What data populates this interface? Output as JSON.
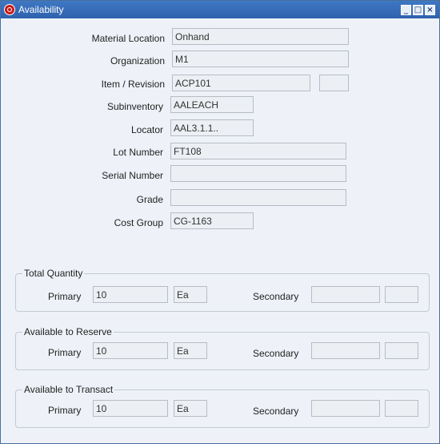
{
  "window": {
    "title": "Availability"
  },
  "form": {
    "material_location": {
      "label": "Material Location",
      "value": "Onhand"
    },
    "organization": {
      "label": "Organization",
      "value": "M1"
    },
    "item_revision": {
      "label": "Item / Revision",
      "value": "ACP101",
      "revision": ""
    },
    "subinventory": {
      "label": "Subinventory",
      "value": "AALEACH"
    },
    "locator": {
      "label": "Locator",
      "value": "AAL3.1.1.."
    },
    "lot_number": {
      "label": "Lot Number",
      "value": "FT108"
    },
    "serial_number": {
      "label": "Serial Number",
      "value": ""
    },
    "grade": {
      "label": "Grade",
      "value": ""
    },
    "cost_group": {
      "label": "Cost Group",
      "value": "CG-1163"
    }
  },
  "groups": [
    {
      "title": "Total Quantity",
      "primary_label": "Primary",
      "primary_value": "10",
      "primary_uom": "Ea",
      "secondary_label": "Secondary",
      "secondary_value": "",
      "secondary_uom": ""
    },
    {
      "title": "Available to Reserve",
      "primary_label": "Primary",
      "primary_value": "10",
      "primary_uom": "Ea",
      "secondary_label": "Secondary",
      "secondary_value": "",
      "secondary_uom": ""
    },
    {
      "title": "Available to Transact",
      "primary_label": "Primary",
      "primary_value": "10",
      "primary_uom": "Ea",
      "secondary_label": "Secondary",
      "secondary_value": "",
      "secondary_uom": ""
    }
  ]
}
